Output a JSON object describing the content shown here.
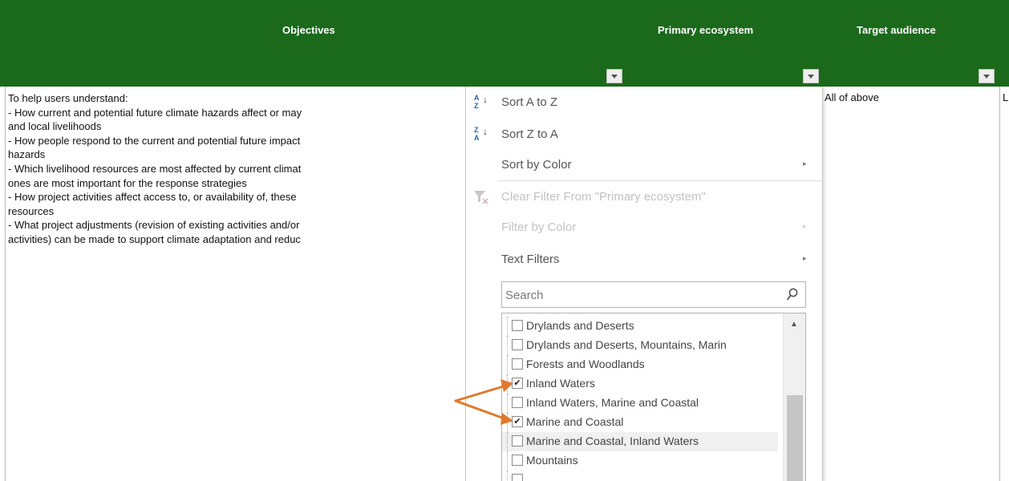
{
  "header": {
    "col_objectives": "Objectives",
    "col_primary_ecosystem": "Primary ecosystem",
    "col_target_audience": "Target audience"
  },
  "objectives_lines": [
    "To help users understand:",
    "- How current and potential future climate hazards affect or may",
    "and local livelihoods",
    "- How people respond to the current and potential future impact",
    "hazards",
    "- Which livelihood resources are most affected by current climat",
    "ones are most important for the response strategies",
    "- How project activities affect access to, or availability of, these",
    "resources",
    "- What project adjustments (revision of existing activities and/or",
    "activities) can be made to support climate adaptation and reduc"
  ],
  "target_audience_value": "All of above",
  "next_column_value": "L",
  "filter_menu": {
    "sort_a_to_z": "Sort A to Z",
    "sort_z_to_a": "Sort Z to A",
    "sort_by_color": "Sort by Color",
    "clear_filter": "Clear Filter From \"Primary ecosystem\"",
    "filter_by_color": "Filter by Color",
    "text_filters": "Text Filters",
    "search_placeholder": "Search",
    "items": [
      {
        "label": "Drylands and Deserts",
        "checked": false
      },
      {
        "label": "Drylands and Deserts, Mountains, Marin",
        "checked": false
      },
      {
        "label": "Forests and Woodlands",
        "checked": false
      },
      {
        "label": "Inland Waters",
        "checked": true
      },
      {
        "label": "Inland Waters, Marine and Coastal",
        "checked": false
      },
      {
        "label": "Marine and Coastal",
        "checked": true
      },
      {
        "label": "Marine and Coastal, Inland Waters",
        "checked": false
      },
      {
        "label": "Mountains",
        "checked": false
      }
    ]
  },
  "colors": {
    "header_green": "#1b6a1b",
    "annotation_orange": "#e07a2e"
  }
}
